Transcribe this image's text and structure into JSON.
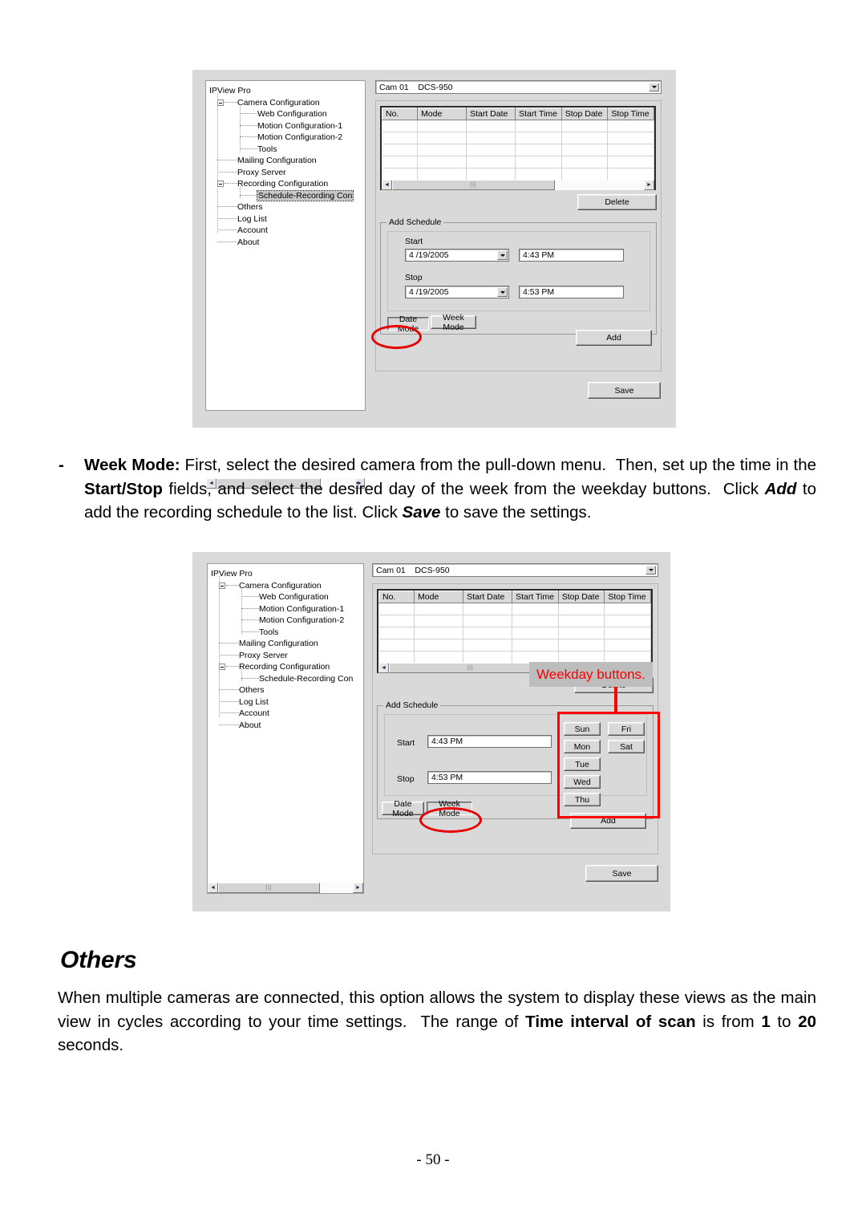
{
  "page": {
    "number_label": "- 50 -"
  },
  "instruction": {
    "bullet": "-",
    "html": "<b>Week Mode:</b> First, select the desired camera from the pull-down menu.&nbsp; Then, set up the time in the <b>Start/Stop</b> fields, and select the desired day of the week from the weekday buttons.&nbsp; Click <i>Add</i> to add the recording schedule to the list. Click <i>Save</i> to save the settings."
  },
  "others_section": {
    "heading": "Others",
    "html": "When multiple cameras are connected, this option allows the system to display these views as the main view in cycles according to your time settings.&nbsp; The range of <b>Time interval of scan</b> is from <b>1</b> to <b>20</b> seconds."
  },
  "colors": {
    "annotation_red": "#fd0000",
    "callout_bg": "#bdbdbd",
    "window_bg": "#d9d9d9",
    "selection_gray": "#c8c8c8"
  },
  "tree": {
    "root": "IPView Pro",
    "items": [
      {
        "label": "Camera Configuration",
        "depth": 1,
        "expander": "minus"
      },
      {
        "label": "Web Configuration",
        "depth": 2,
        "expander": "none"
      },
      {
        "label": "Motion Configuration-1",
        "depth": 2,
        "expander": "none"
      },
      {
        "label": "Motion Configuration-2",
        "depth": 2,
        "expander": "none"
      },
      {
        "label": "Tools",
        "depth": 2,
        "expander": "none"
      },
      {
        "label": "Mailing Configuration",
        "depth": 1,
        "expander": "none"
      },
      {
        "label": "Proxy Server",
        "depth": 1,
        "expander": "none"
      },
      {
        "label": "Recording Configuration",
        "depth": 1,
        "expander": "minus"
      },
      {
        "label": "Schedule-Recording Con",
        "depth": 2,
        "expander": "none"
      },
      {
        "label": "Others",
        "depth": 1,
        "expander": "none"
      },
      {
        "label": "Log List",
        "depth": 1,
        "expander": "none"
      },
      {
        "label": "Account",
        "depth": 1,
        "expander": "none"
      },
      {
        "label": "About",
        "depth": 1,
        "expander": "none"
      }
    ]
  },
  "camera_combo": {
    "value": "Cam 01    DCS-950",
    "arrow_icon": "chevron-down-icon"
  },
  "schedule_grid": {
    "columns": [
      "No.",
      "Mode",
      "Start Date",
      "Start Time",
      "Stop Date",
      "Stop Time"
    ],
    "rows": [],
    "empty_row_count": 6
  },
  "buttons": {
    "delete": "Delete",
    "add": "Add",
    "save": "Save",
    "date_mode": "Date Mode",
    "week_mode": "Week Mode"
  },
  "shot_date_mode": {
    "groupbox_title": "Add Schedule",
    "start_label": "Start",
    "stop_label": "Stop",
    "start_date": "4 /19/2005",
    "start_time": "4:43 PM",
    "stop_date": "4 /19/2005",
    "stop_time": "4:53 PM",
    "active_tab": "Date Mode",
    "highlighted_tree_item": "Schedule-Recording Con"
  },
  "shot_week_mode": {
    "groupbox_title": "Add Schedule",
    "start_label": "Start",
    "stop_label": "Stop",
    "start_time": "4:43 PM",
    "stop_time": "4:53 PM",
    "active_tab": "Week Mode",
    "weekday_buttons_col1": [
      "Sun",
      "Mon",
      "Tue",
      "Wed",
      "Thu"
    ],
    "weekday_buttons_col2": [
      "Fri",
      "Sat"
    ],
    "callout": "Weekday buttons."
  },
  "scrollbar": {
    "left_arrow": "◄",
    "right_arrow": "►",
    "grip": "|||"
  }
}
